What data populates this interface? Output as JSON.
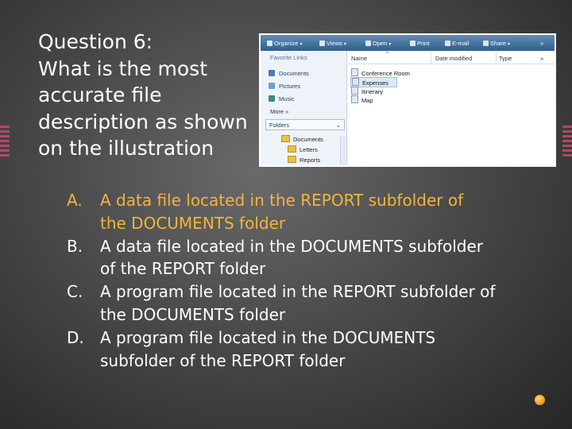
{
  "question": {
    "lines": [
      "Question 6:",
      "What is the most",
      "accurate file",
      "description as shown",
      "on the illustration"
    ]
  },
  "explorer": {
    "toolbar": [
      "Organize",
      "Views",
      "Open",
      "Print",
      "E-mail",
      "Share"
    ],
    "more_arrows": "»",
    "nav_header": "Favorite Links",
    "favorites": [
      {
        "label": "Documents",
        "icon": "documents-icon"
      },
      {
        "label": "Pictures",
        "icon": "pictures-icon"
      },
      {
        "label": "Music",
        "icon": "music-icon"
      }
    ],
    "more_label": "More »",
    "folders_label": "Folders",
    "folders_chevron": "⌄",
    "tree": [
      "Documents",
      "Letters",
      "Reports"
    ],
    "columns": [
      "Name",
      "Date modified",
      "Type"
    ],
    "files": [
      "Conference Room",
      "Expenses",
      "Itinerary",
      "Map"
    ],
    "selected_index": 1
  },
  "answers": [
    {
      "letter": "A.",
      "lines": [
        "A data file located in the REPORT subfolder of",
        "the DOCUMENTS folder"
      ]
    },
    {
      "letter": "B.",
      "lines": [
        "A data file located in the DOCUMENTS subfolder",
        "of the  REPORT  folder"
      ]
    },
    {
      "letter": "C.",
      "lines": [
        "A program file located in the REPORT subfolder of",
        "the DOCUMENTS folder"
      ]
    },
    {
      "letter": "D.",
      "lines": [
        "A program file located in the DOCUMENTS",
        "subfolder of the  REPORT  folder"
      ]
    }
  ],
  "colors": {
    "highlight": "#f4b43c",
    "text": "#ffffff",
    "accent_stripes": "#c8486a"
  }
}
